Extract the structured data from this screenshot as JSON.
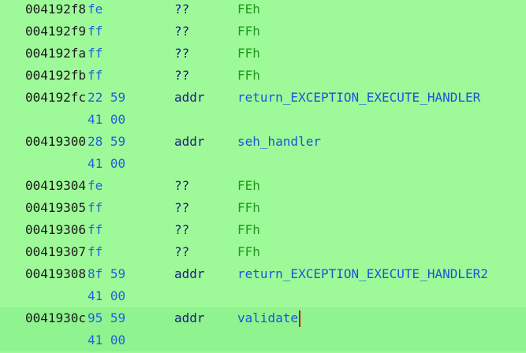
{
  "listing": {
    "rows": [
      {
        "address": "004192f8",
        "bytes": "fe",
        "mnemonic": "??",
        "operand": "FEh",
        "operand_kind": "scalar"
      },
      {
        "address": "004192f9",
        "bytes": "ff",
        "mnemonic": "??",
        "operand": "FFh",
        "operand_kind": "scalar"
      },
      {
        "address": "004192fa",
        "bytes": "ff",
        "mnemonic": "??",
        "operand": "FFh",
        "operand_kind": "scalar"
      },
      {
        "address": "004192fb",
        "bytes": "ff",
        "mnemonic": "??",
        "operand": "FFh",
        "operand_kind": "scalar"
      },
      {
        "address": "004192fc",
        "bytes": "22 59",
        "mnemonic": "addr",
        "operand": "return_EXCEPTION_EXECUTE_HANDLER",
        "operand_kind": "label"
      },
      {
        "address": "",
        "bytes": "41 00",
        "mnemonic": "",
        "operand": "",
        "operand_kind": "none"
      },
      {
        "address": "00419300",
        "bytes": "28 59",
        "mnemonic": "addr",
        "operand": "seh_handler",
        "operand_kind": "label"
      },
      {
        "address": "",
        "bytes": "41 00",
        "mnemonic": "",
        "operand": "",
        "operand_kind": "none"
      },
      {
        "address": "00419304",
        "bytes": "fe",
        "mnemonic": "??",
        "operand": "FEh",
        "operand_kind": "scalar"
      },
      {
        "address": "00419305",
        "bytes": "ff",
        "mnemonic": "??",
        "operand": "FFh",
        "operand_kind": "scalar"
      },
      {
        "address": "00419306",
        "bytes": "ff",
        "mnemonic": "??",
        "operand": "FFh",
        "operand_kind": "scalar"
      },
      {
        "address": "00419307",
        "bytes": "ff",
        "mnemonic": "??",
        "operand": "FFh",
        "operand_kind": "scalar"
      },
      {
        "address": "00419308",
        "bytes": "8f 59",
        "mnemonic": "addr",
        "operand": "return_EXCEPTION_EXECUTE_HANDLER2",
        "operand_kind": "label"
      },
      {
        "address": "",
        "bytes": "41 00",
        "mnemonic": "",
        "operand": "",
        "operand_kind": "none"
      },
      {
        "address": "0041930c",
        "bytes": "95 59",
        "mnemonic": "addr",
        "operand": "validate",
        "operand_kind": "label",
        "current": true
      },
      {
        "address": "",
        "bytes": "41 00",
        "mnemonic": "",
        "operand": "",
        "operand_kind": "none",
        "current": true
      }
    ]
  },
  "colors": {
    "background": "#9efa98",
    "current_line": "#8ff38f",
    "address": "#1a1a1a",
    "bytes": "#2060e0",
    "mnemonic": "#1a1a80",
    "scalar_operand": "#1a9a1a",
    "label_operand": "#1a55d8",
    "cursor": "#d01010"
  }
}
